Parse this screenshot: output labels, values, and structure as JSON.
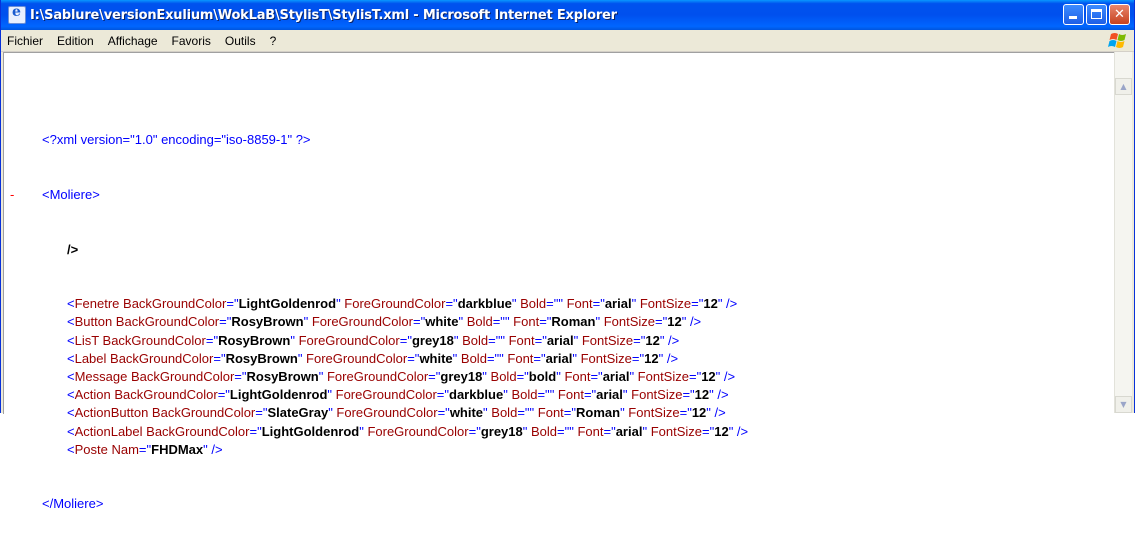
{
  "window": {
    "title": "I:\\Sablure\\versionExulium\\WokLaB\\StylisT\\StylisT.xml - Microsoft Internet Explorer",
    "app_icon": "ie-icon",
    "controls": [
      "minimize-icon",
      "maximize-icon",
      "close-icon"
    ]
  },
  "menu": {
    "items": [
      "Fichier",
      "Edition",
      "Affichage",
      "Favoris",
      "Outils",
      "?"
    ]
  },
  "xml": {
    "declaration": "<?xml version=\"1.0\" encoding=\"iso-8859-1\" ?>",
    "collapse_marker": "-",
    "root_open": "<Moliere>",
    "lone_close": "/>",
    "root_close": "</Moliere>",
    "elements": [
      {
        "tag": "Fenetre",
        "attrs": [
          [
            "BackGroundColor",
            "LightGoldenrod"
          ],
          [
            "ForeGroundColor",
            "darkblue"
          ],
          [
            "Bold",
            ""
          ],
          [
            "Font",
            "arial"
          ],
          [
            "FontSize",
            "12"
          ]
        ]
      },
      {
        "tag": "Button",
        "attrs": [
          [
            "BackGroundColor",
            "RosyBrown"
          ],
          [
            "ForeGroundColor",
            "white"
          ],
          [
            "Bold",
            ""
          ],
          [
            "Font",
            "Roman"
          ],
          [
            "FontSize",
            "12"
          ]
        ]
      },
      {
        "tag": "LisT",
        "attrs": [
          [
            "BackGroundColor",
            "RosyBrown"
          ],
          [
            "ForeGroundColor",
            "grey18"
          ],
          [
            "Bold",
            ""
          ],
          [
            "Font",
            "arial"
          ],
          [
            "FontSize",
            "12"
          ]
        ]
      },
      {
        "tag": "Label",
        "attrs": [
          [
            "BackGroundColor",
            "RosyBrown"
          ],
          [
            "ForeGroundColor",
            "white"
          ],
          [
            "Bold",
            ""
          ],
          [
            "Font",
            "arial"
          ],
          [
            "FontSize",
            "12"
          ]
        ]
      },
      {
        "tag": "Message",
        "attrs": [
          [
            "BackGroundColor",
            "RosyBrown"
          ],
          [
            "ForeGroundColor",
            "grey18"
          ],
          [
            "Bold",
            "bold"
          ],
          [
            "Font",
            "arial"
          ],
          [
            "FontSize",
            "12"
          ]
        ]
      },
      {
        "tag": "Action",
        "attrs": [
          [
            "BackGroundColor",
            "LightGoldenrod"
          ],
          [
            "ForeGroundColor",
            "darkblue"
          ],
          [
            "Bold",
            ""
          ],
          [
            "Font",
            "arial"
          ],
          [
            "FontSize",
            "12"
          ]
        ]
      },
      {
        "tag": "ActionButton",
        "attrs": [
          [
            "BackGroundColor",
            "SlateGray"
          ],
          [
            "ForeGroundColor",
            "white"
          ],
          [
            "Bold",
            ""
          ],
          [
            "Font",
            "Roman"
          ],
          [
            "FontSize",
            "12"
          ]
        ]
      },
      {
        "tag": "ActionLabel",
        "attrs": [
          [
            "BackGroundColor",
            "LightGoldenrod"
          ],
          [
            "ForeGroundColor",
            "grey18"
          ],
          [
            "Bold",
            ""
          ],
          [
            "Font",
            "arial"
          ],
          [
            "FontSize",
            "12"
          ]
        ]
      },
      {
        "tag": "Poste",
        "attrs": [
          [
            "Nam",
            "FHDMax"
          ]
        ]
      }
    ]
  },
  "colors": {
    "titlebar": "#0054e3",
    "xml_markup": "#0000ff",
    "xml_names": "#990000",
    "xml_values": "#000000",
    "collapse_marker": "#ff0000"
  }
}
